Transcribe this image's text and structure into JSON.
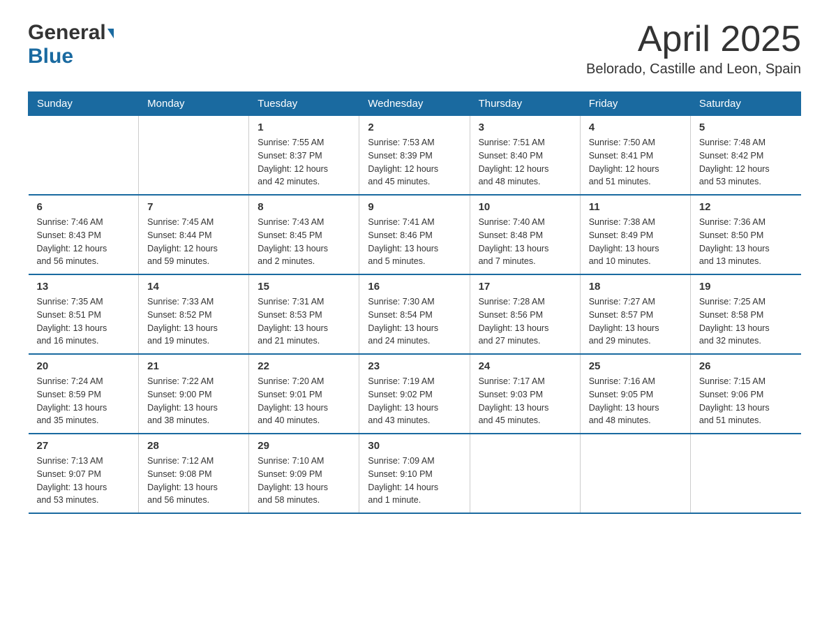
{
  "header": {
    "title": "April 2025",
    "subtitle": "Belorado, Castille and Leon, Spain",
    "logo_general": "General",
    "logo_blue": "Blue"
  },
  "days_of_week": [
    "Sunday",
    "Monday",
    "Tuesday",
    "Wednesday",
    "Thursday",
    "Friday",
    "Saturday"
  ],
  "weeks": [
    [
      {
        "day": "",
        "info": ""
      },
      {
        "day": "",
        "info": ""
      },
      {
        "day": "1",
        "info": "Sunrise: 7:55 AM\nSunset: 8:37 PM\nDaylight: 12 hours\nand 42 minutes."
      },
      {
        "day": "2",
        "info": "Sunrise: 7:53 AM\nSunset: 8:39 PM\nDaylight: 12 hours\nand 45 minutes."
      },
      {
        "day": "3",
        "info": "Sunrise: 7:51 AM\nSunset: 8:40 PM\nDaylight: 12 hours\nand 48 minutes."
      },
      {
        "day": "4",
        "info": "Sunrise: 7:50 AM\nSunset: 8:41 PM\nDaylight: 12 hours\nand 51 minutes."
      },
      {
        "day": "5",
        "info": "Sunrise: 7:48 AM\nSunset: 8:42 PM\nDaylight: 12 hours\nand 53 minutes."
      }
    ],
    [
      {
        "day": "6",
        "info": "Sunrise: 7:46 AM\nSunset: 8:43 PM\nDaylight: 12 hours\nand 56 minutes."
      },
      {
        "day": "7",
        "info": "Sunrise: 7:45 AM\nSunset: 8:44 PM\nDaylight: 12 hours\nand 59 minutes."
      },
      {
        "day": "8",
        "info": "Sunrise: 7:43 AM\nSunset: 8:45 PM\nDaylight: 13 hours\nand 2 minutes."
      },
      {
        "day": "9",
        "info": "Sunrise: 7:41 AM\nSunset: 8:46 PM\nDaylight: 13 hours\nand 5 minutes."
      },
      {
        "day": "10",
        "info": "Sunrise: 7:40 AM\nSunset: 8:48 PM\nDaylight: 13 hours\nand 7 minutes."
      },
      {
        "day": "11",
        "info": "Sunrise: 7:38 AM\nSunset: 8:49 PM\nDaylight: 13 hours\nand 10 minutes."
      },
      {
        "day": "12",
        "info": "Sunrise: 7:36 AM\nSunset: 8:50 PM\nDaylight: 13 hours\nand 13 minutes."
      }
    ],
    [
      {
        "day": "13",
        "info": "Sunrise: 7:35 AM\nSunset: 8:51 PM\nDaylight: 13 hours\nand 16 minutes."
      },
      {
        "day": "14",
        "info": "Sunrise: 7:33 AM\nSunset: 8:52 PM\nDaylight: 13 hours\nand 19 minutes."
      },
      {
        "day": "15",
        "info": "Sunrise: 7:31 AM\nSunset: 8:53 PM\nDaylight: 13 hours\nand 21 minutes."
      },
      {
        "day": "16",
        "info": "Sunrise: 7:30 AM\nSunset: 8:54 PM\nDaylight: 13 hours\nand 24 minutes."
      },
      {
        "day": "17",
        "info": "Sunrise: 7:28 AM\nSunset: 8:56 PM\nDaylight: 13 hours\nand 27 minutes."
      },
      {
        "day": "18",
        "info": "Sunrise: 7:27 AM\nSunset: 8:57 PM\nDaylight: 13 hours\nand 29 minutes."
      },
      {
        "day": "19",
        "info": "Sunrise: 7:25 AM\nSunset: 8:58 PM\nDaylight: 13 hours\nand 32 minutes."
      }
    ],
    [
      {
        "day": "20",
        "info": "Sunrise: 7:24 AM\nSunset: 8:59 PM\nDaylight: 13 hours\nand 35 minutes."
      },
      {
        "day": "21",
        "info": "Sunrise: 7:22 AM\nSunset: 9:00 PM\nDaylight: 13 hours\nand 38 minutes."
      },
      {
        "day": "22",
        "info": "Sunrise: 7:20 AM\nSunset: 9:01 PM\nDaylight: 13 hours\nand 40 minutes."
      },
      {
        "day": "23",
        "info": "Sunrise: 7:19 AM\nSunset: 9:02 PM\nDaylight: 13 hours\nand 43 minutes."
      },
      {
        "day": "24",
        "info": "Sunrise: 7:17 AM\nSunset: 9:03 PM\nDaylight: 13 hours\nand 45 minutes."
      },
      {
        "day": "25",
        "info": "Sunrise: 7:16 AM\nSunset: 9:05 PM\nDaylight: 13 hours\nand 48 minutes."
      },
      {
        "day": "26",
        "info": "Sunrise: 7:15 AM\nSunset: 9:06 PM\nDaylight: 13 hours\nand 51 minutes."
      }
    ],
    [
      {
        "day": "27",
        "info": "Sunrise: 7:13 AM\nSunset: 9:07 PM\nDaylight: 13 hours\nand 53 minutes."
      },
      {
        "day": "28",
        "info": "Sunrise: 7:12 AM\nSunset: 9:08 PM\nDaylight: 13 hours\nand 56 minutes."
      },
      {
        "day": "29",
        "info": "Sunrise: 7:10 AM\nSunset: 9:09 PM\nDaylight: 13 hours\nand 58 minutes."
      },
      {
        "day": "30",
        "info": "Sunrise: 7:09 AM\nSunset: 9:10 PM\nDaylight: 14 hours\nand 1 minute."
      },
      {
        "day": "",
        "info": ""
      },
      {
        "day": "",
        "info": ""
      },
      {
        "day": "",
        "info": ""
      }
    ]
  ]
}
